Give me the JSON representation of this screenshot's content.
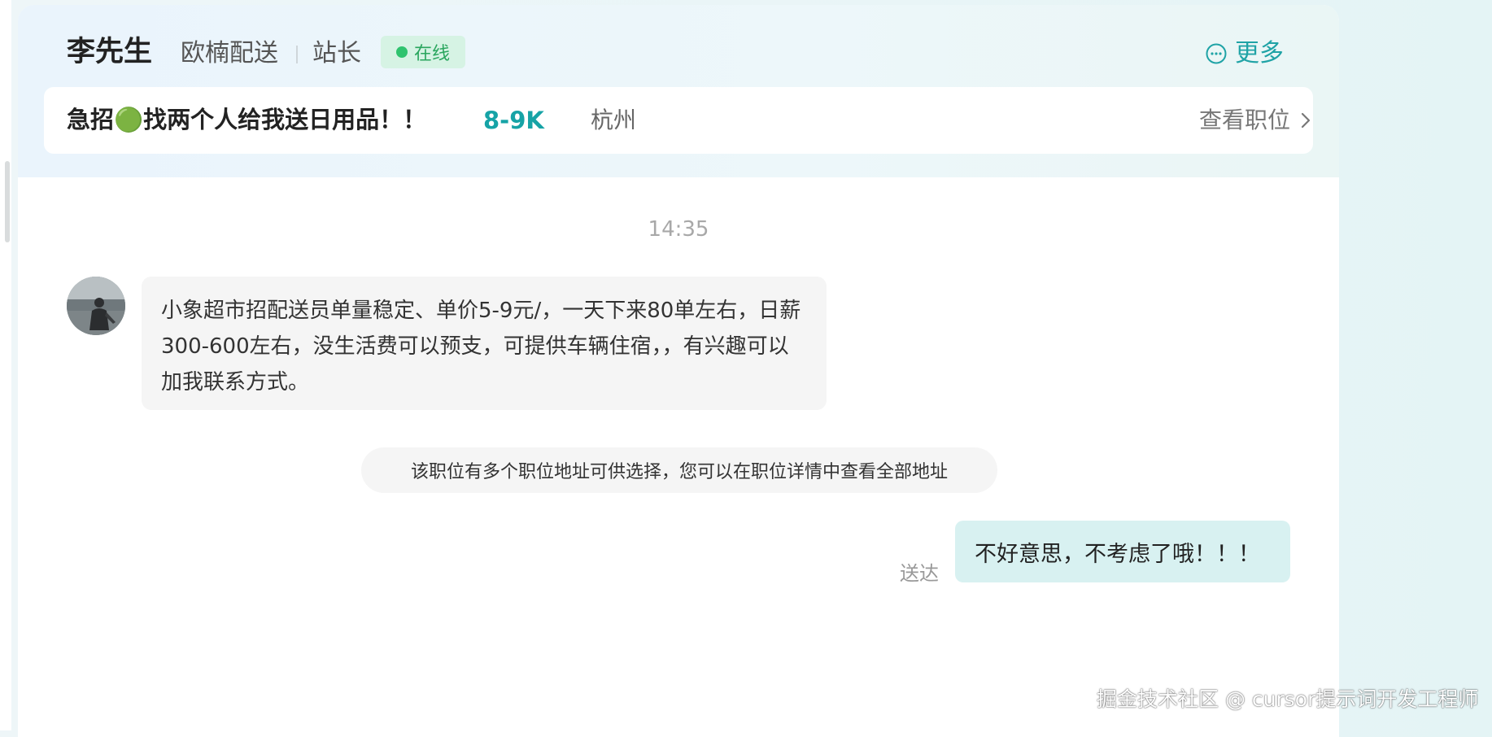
{
  "header": {
    "contact_name": "李先生",
    "company": "欧楠配送",
    "role": "站长",
    "status": "在线",
    "more_label": "更多",
    "more_icon": "more-circle-icon"
  },
  "job": {
    "title": "急招🟢找两个人给我送日用品！！",
    "salary": "8-9K",
    "location": "杭州",
    "view_label": "查看职位",
    "view_icon": "chevron-right-icon"
  },
  "chat": {
    "timestamp": "14:35",
    "messages": [
      {
        "from": "contact",
        "text": "小象超市招配送员单量稳定、单价5-9元/，一天下来80单左右，日薪300-600左右，没生活费可以预支，可提供车辆住宿，，有兴趣可以加我联系方式。"
      },
      {
        "from": "system",
        "text": "该职位有多个职位地址可供选择，您可以在职位详情中查看全部地址"
      },
      {
        "from": "me",
        "text": "不好意思，不考虑了哦！！！",
        "status": "送达"
      }
    ]
  },
  "watermark": "掘金技术社区 @ cursor提示词开发工程师",
  "colors": {
    "accent": "#16a3a6",
    "online": "#2fc36e",
    "sent_bubble": "#d8f1f1",
    "received_bubble": "#f5f5f5"
  }
}
